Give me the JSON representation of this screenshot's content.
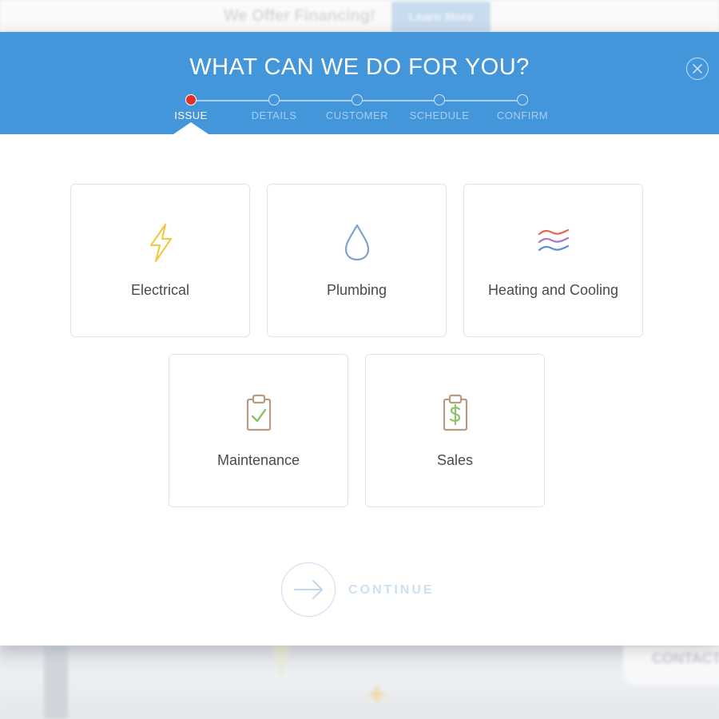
{
  "background": {
    "promo_text": "We Offer Financing!",
    "learn_more_label": "Learn More",
    "contact_label": "CONTACT"
  },
  "modal": {
    "title": "WHAT CAN WE DO FOR YOU?",
    "close_icon": "close-circle-icon",
    "steps": [
      {
        "label": "ISSUE",
        "active": true
      },
      {
        "label": "DETAILS",
        "active": false
      },
      {
        "label": "CUSTOMER",
        "active": false
      },
      {
        "label": "SCHEDULE",
        "active": false
      },
      {
        "label": "CONFIRM",
        "active": false
      }
    ],
    "options": [
      {
        "label": "Electrical",
        "icon": "lightning-bolt-icon"
      },
      {
        "label": "Plumbing",
        "icon": "water-drop-icon"
      },
      {
        "label": "Heating and Cooling",
        "icon": "heat-waves-icon"
      },
      {
        "label": "Maintenance",
        "icon": "clipboard-check-icon"
      },
      {
        "label": "Sales",
        "icon": "clipboard-dollar-icon"
      }
    ],
    "continue_label": "CONTINUE",
    "continue_icon": "arrow-right-icon"
  },
  "colors": {
    "header_blue": "#4396da",
    "active_step": "#e0312a",
    "bolt": "#f2c94c",
    "drop": "#7fa3d1",
    "wave_red": "#e4664f",
    "wave_purple": "#a779c9",
    "wave_blue": "#5b8fd6",
    "clipboard": "#b89c82",
    "check_green": "#8dc26b"
  }
}
